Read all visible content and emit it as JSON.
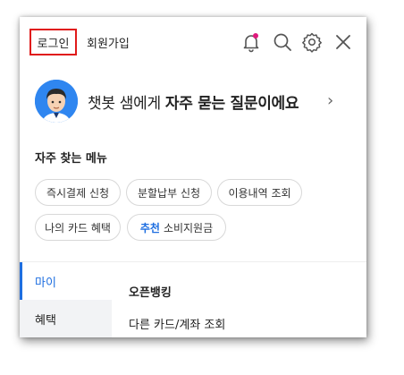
{
  "header": {
    "login_label": "로그인",
    "signup_label": "회원가입",
    "notification_dot_color": "#e0197d"
  },
  "chatbot": {
    "prefix": "챗봇 샘에게 ",
    "emphasis": "자주 묻는 질문이에요",
    "chevron": "›"
  },
  "frequent_menu": {
    "title": "자주 찾는 메뉴",
    "chips": [
      {
        "label": "즉시결제 신청"
      },
      {
        "label": "분할납부 신청"
      },
      {
        "label": "이용내역 조회"
      },
      {
        "label": "나의 카드 혜택"
      },
      {
        "highlight": "추천",
        "label": "소비지원금"
      }
    ]
  },
  "side_tabs": [
    {
      "label": "마이",
      "active": true
    },
    {
      "label": "혜택",
      "active": false
    }
  ],
  "content": {
    "section_title": "오픈뱅킹",
    "items": [
      "다른 카드/계좌 조회"
    ]
  },
  "colors": {
    "accent": "#1e6ee0",
    "highlight_border": "#e01a1a",
    "avatar_bg": "#2f86f0"
  }
}
